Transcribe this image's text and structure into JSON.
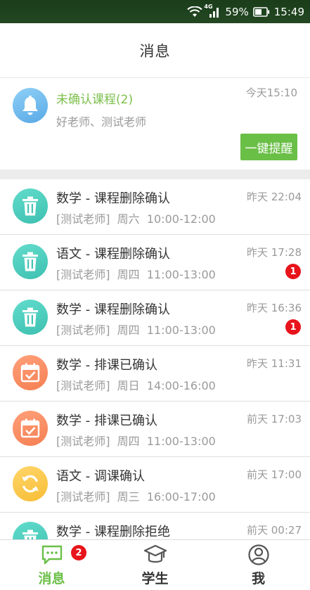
{
  "status_bar": {
    "network": "4G",
    "battery": "59%",
    "time": "15:49"
  },
  "header": {
    "title": "消息"
  },
  "pending": {
    "title": "未确认课程(2)",
    "subtitle": "好老师、测试老师",
    "time": "今天15:10",
    "remind_label": "一键提醒",
    "icon": "bell-icon"
  },
  "messages": [
    {
      "title": "数学 - 课程删除确认",
      "sub": "[测试老师]  周六  10:00-12:00",
      "time": "昨天 22:04",
      "badge": "",
      "icon": "trash-icon",
      "color": "teal"
    },
    {
      "title": "语文 - 课程删除确认",
      "sub": "[测试老师]  周四  11:00-13:00",
      "time": "昨天 17:28",
      "badge": "1",
      "icon": "trash-icon",
      "color": "teal"
    },
    {
      "title": "数学 - 课程删除确认",
      "sub": "[测试老师]  周四  11:00-13:00",
      "time": "昨天 16:36",
      "badge": "1",
      "icon": "trash-icon",
      "color": "teal"
    },
    {
      "title": "数学 - 排课已确认",
      "sub": "[测试老师]  周日  14:00-16:00",
      "time": "昨天 11:31",
      "badge": "",
      "icon": "calendar-check-icon",
      "color": "orange"
    },
    {
      "title": "数学 - 排课已确认",
      "sub": "[测试老师]  周四  11:00-13:00",
      "time": "前天 17:03",
      "badge": "",
      "icon": "calendar-check-icon",
      "color": "orange"
    },
    {
      "title": "语文 - 调课确认",
      "sub": "[测试老师]  周三  16:00-17:00",
      "time": "前天 17:00",
      "badge": "",
      "icon": "refresh-icon",
      "color": "yellow"
    },
    {
      "title": "数学 - 课程删除拒绝",
      "sub": "",
      "time": "前天 00:27",
      "badge": "",
      "icon": "trash-icon",
      "color": "teal"
    }
  ],
  "tabs": [
    {
      "label": "消息",
      "icon": "chat-icon",
      "badge": "2",
      "active": true
    },
    {
      "label": "学生",
      "icon": "graduation-cap-icon",
      "badge": "",
      "active": false
    },
    {
      "label": "我",
      "icon": "user-icon",
      "badge": "",
      "active": false
    }
  ],
  "colors": {
    "accent_green": "#6abf47",
    "pending_title_green": "#7cbf4a",
    "badge_red": "#e8141b",
    "teal": "#4ccfbf",
    "orange": "#f78c62",
    "yellow": "#f9c647",
    "status_bar": "#1f421e"
  }
}
